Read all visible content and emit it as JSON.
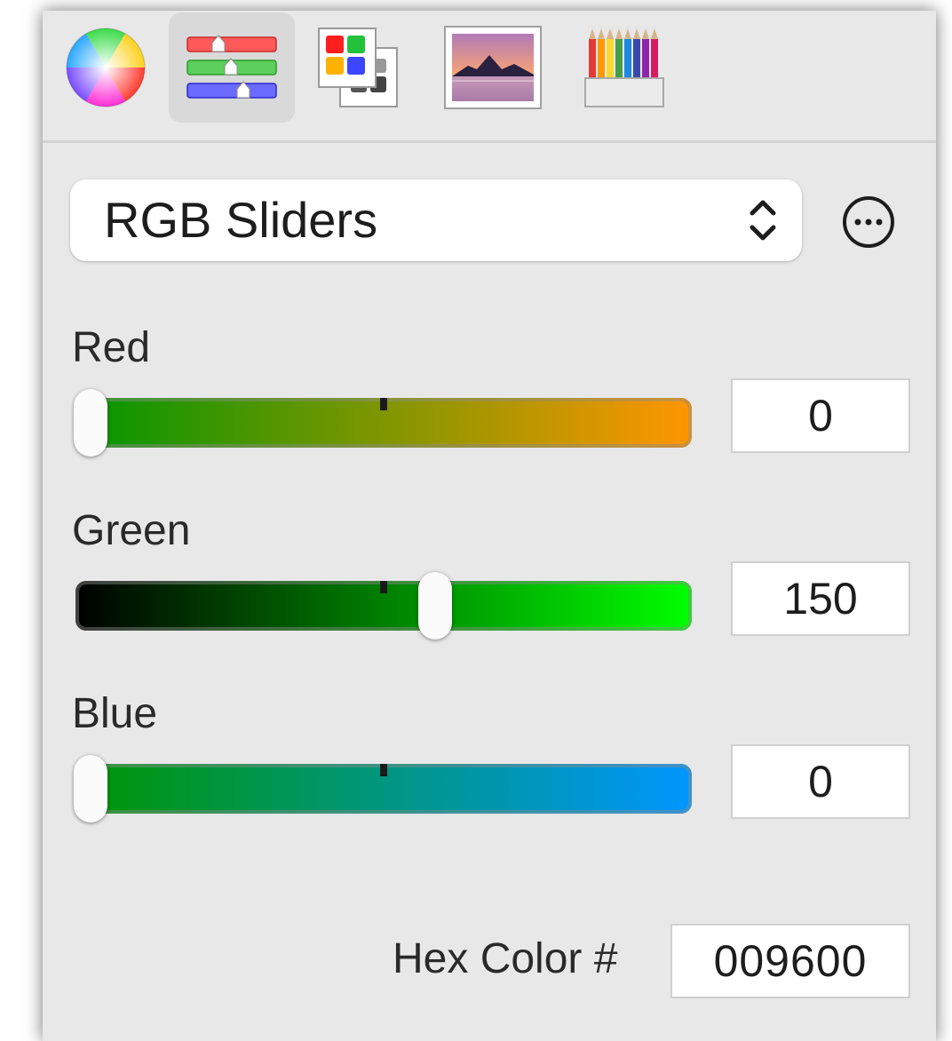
{
  "toolbar": {
    "tabs": [
      {
        "name": "color-wheel",
        "icon": "color-wheel-icon",
        "selected": false
      },
      {
        "name": "color-sliders",
        "icon": "sliders-icon",
        "selected": true
      },
      {
        "name": "color-palettes",
        "icon": "palettes-icon",
        "selected": false
      },
      {
        "name": "image-palettes",
        "icon": "image-palette-icon",
        "selected": false
      },
      {
        "name": "pencils",
        "icon": "pencils-icon",
        "selected": false
      }
    ]
  },
  "slider_mode": {
    "selected": "RGB Sliders",
    "options_icon": "ellipsis-circle-icon"
  },
  "sliders": {
    "red": {
      "label": "Red",
      "value": "0",
      "max": 255,
      "gradient": [
        "#009600",
        "#ff9600"
      ]
    },
    "green": {
      "label": "Green",
      "value": "150",
      "max": 255,
      "gradient": [
        "#000000",
        "#00ff00"
      ]
    },
    "blue": {
      "label": "Blue",
      "value": "0",
      "max": 255,
      "gradient": [
        "#009600",
        "#0096ff"
      ]
    }
  },
  "hex": {
    "label": "Hex Color #",
    "value": "009600"
  }
}
